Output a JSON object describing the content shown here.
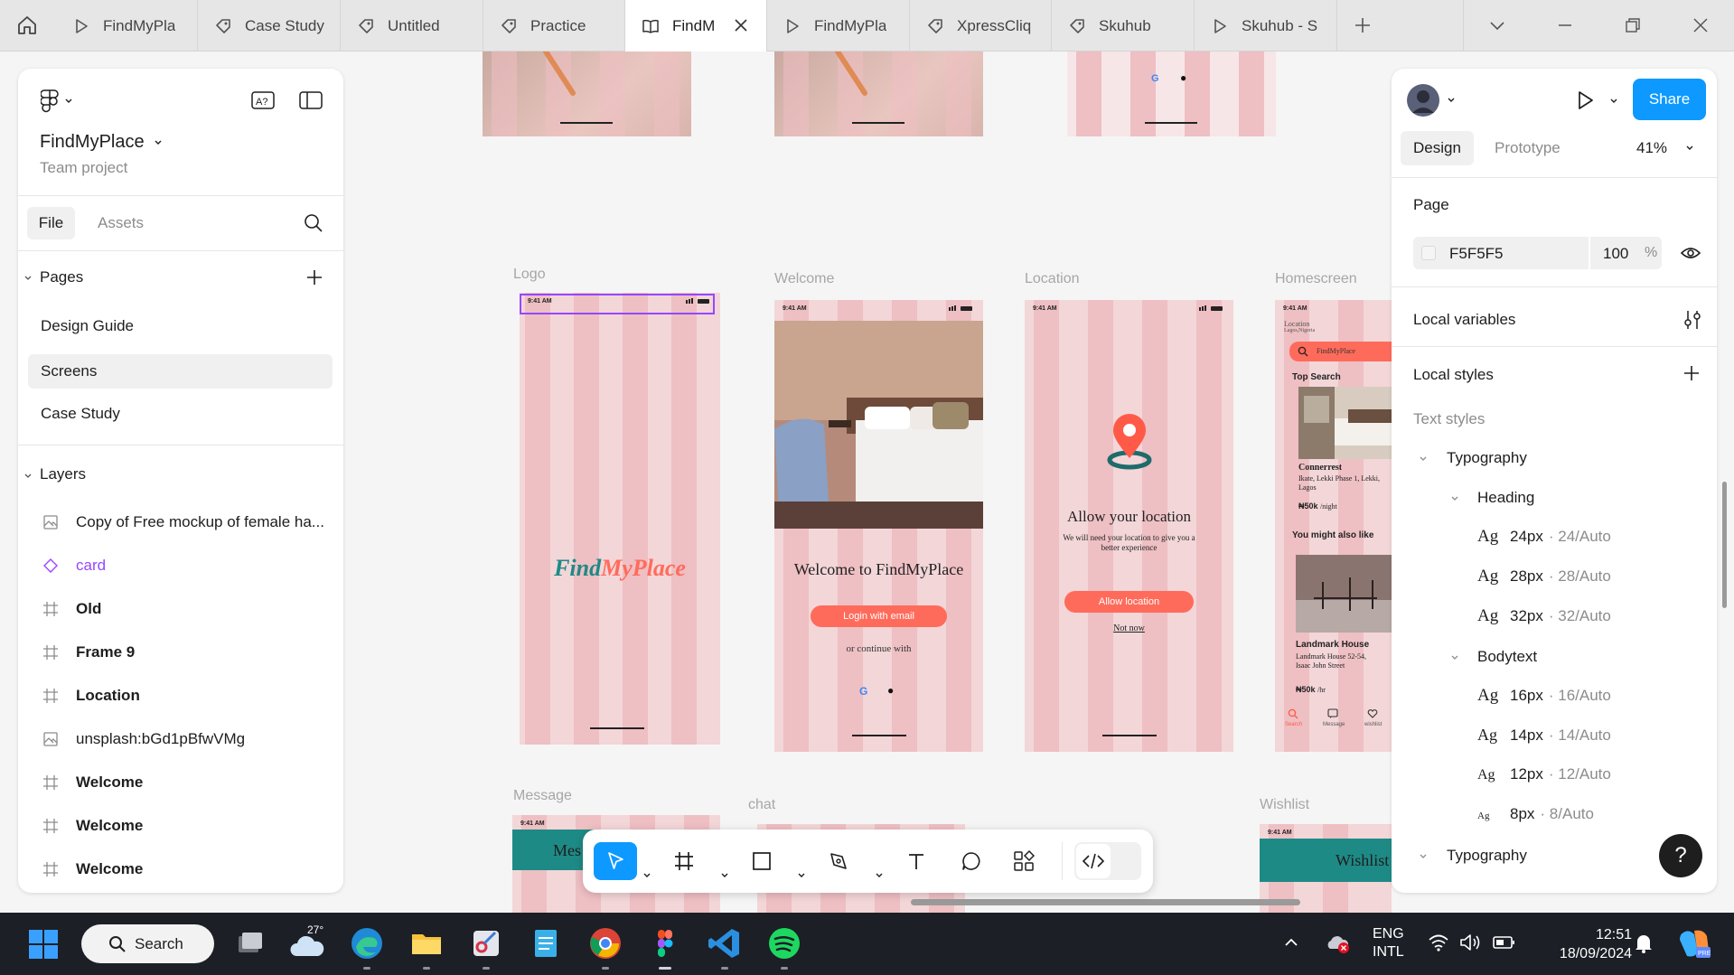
{
  "tabs": [
    {
      "label": "FindMyPla",
      "icon": "play-icon"
    },
    {
      "label": "Case Study",
      "icon": "pen-tag-icon"
    },
    {
      "label": "Untitled",
      "icon": "pen-tag-icon"
    },
    {
      "label": "Practice",
      "icon": "pen-tag-icon"
    },
    {
      "label": "FindM",
      "icon": "book-icon",
      "active": true
    },
    {
      "label": "FindMyPla",
      "icon": "play-icon"
    },
    {
      "label": "XpressCliq",
      "icon": "pen-tag-icon"
    },
    {
      "label": "Skuhub",
      "icon": "pen-tag-icon"
    },
    {
      "label": "Skuhub - S",
      "icon": "play-icon"
    }
  ],
  "left_panel": {
    "project_name": "FindMyPlace",
    "project_type": "Team project",
    "tabs": {
      "file": "File",
      "assets": "Assets"
    },
    "pages_header": "Pages",
    "pages": [
      "Design Guide",
      "Screens",
      "Case Study"
    ],
    "selected_page": "Screens",
    "layers_header": "Layers",
    "layers": [
      {
        "name": "Copy of Free mockup of female ha...",
        "icon": "image-icon",
        "bold": false
      },
      {
        "name": "card",
        "icon": "component-icon",
        "bold": false,
        "color": "#9747ff"
      },
      {
        "name": "Old",
        "icon": "frame-icon",
        "bold": true
      },
      {
        "name": "Frame 9",
        "icon": "frame-icon",
        "bold": true
      },
      {
        "name": "Location",
        "icon": "frame-icon",
        "bold": true
      },
      {
        "name": "unsplash:bGd1pBfwVMg",
        "icon": "image-icon",
        "bold": false
      },
      {
        "name": "Welcome",
        "icon": "frame-icon",
        "bold": true
      },
      {
        "name": "Welcome",
        "icon": "frame-icon",
        "bold": true
      },
      {
        "name": "Welcome",
        "icon": "frame-icon",
        "bold": true
      }
    ]
  },
  "right_panel": {
    "share_label": "Share",
    "tabs": {
      "design": "Design",
      "prototype": "Prototype"
    },
    "zoom": "41%",
    "page_section": "Page",
    "page_color": "F5F5F5",
    "page_opacity": "100",
    "page_opacity_unit": "%",
    "local_variables": "Local variables",
    "local_styles": "Local styles",
    "text_styles": "Text styles",
    "typography_group": "Typography",
    "heading_group": "Heading",
    "heading_styles": [
      {
        "size": "24px",
        "meta": "· 24/Auto"
      },
      {
        "size": "28px",
        "meta": "· 28/Auto"
      },
      {
        "size": "32px",
        "meta": "· 32/Auto"
      }
    ],
    "bodytext_group": "Bodytext",
    "body_styles": [
      {
        "size": "16px",
        "meta": "· 16/Auto"
      },
      {
        "size": "14px",
        "meta": "· 14/Auto"
      },
      {
        "size": "12px",
        "meta": "· 12/Auto"
      },
      {
        "size": "8px",
        "meta": "· 8/Auto"
      }
    ],
    "typography_group_2": "Typography",
    "help_label": "?",
    "ag_label": "Ag"
  },
  "canvas": {
    "frame_labels": {
      "logo": "Logo",
      "welcome": "Welcome",
      "location": "Location",
      "homescreen": "Homescreen",
      "message": "Message",
      "chat": "chat",
      "wishlist": "Wishlist"
    },
    "status_time": "9:41 AM",
    "logo_text_a": "Find",
    "logo_text_b": "MyPlace",
    "welcome_title": "Welcome to FindMyPlace",
    "welcome_button": "Login with email",
    "welcome_continue": "or continue with",
    "location_title": "Allow your location",
    "location_body": "We will need your location to give you a better experience",
    "location_button": "Allow location",
    "location_not_now": "Not now",
    "home_location_label": "Location",
    "home_location_value": "Lagos,Nigeria",
    "home_search": "FindMyPlace",
    "home_top_search": "Top Search",
    "home_card1_title": "Connerrest",
    "home_card1_addr": "Ikate, Lekki Phase 1, Lekki, Lagos",
    "home_card1_price": "₦50k",
    "home_card1_unit": "/night",
    "home_also_like": "You might also like",
    "home_card2_title": "Landmark House",
    "home_card2_addr": "Landmark House 52-54, Isaac John Street",
    "home_card2_price": "₦50k",
    "home_card2_unit": "/hr",
    "home_nav": [
      "Search",
      "Message",
      "wishlist"
    ],
    "message_banner": "Mes",
    "wishlist_banner": "Wishlist"
  },
  "taskbar": {
    "search_label": "Search",
    "weather_temp": "27°",
    "lang_line1": "ENG",
    "lang_line2": "INTL",
    "time": "12:51",
    "date": "18/09/2024"
  },
  "colors": {
    "accent": "#0d99ff",
    "coral": "#ff6b5b",
    "teal": "#1e8a86",
    "phone_bg": "#f3d6d8",
    "component": "#9747ff"
  }
}
